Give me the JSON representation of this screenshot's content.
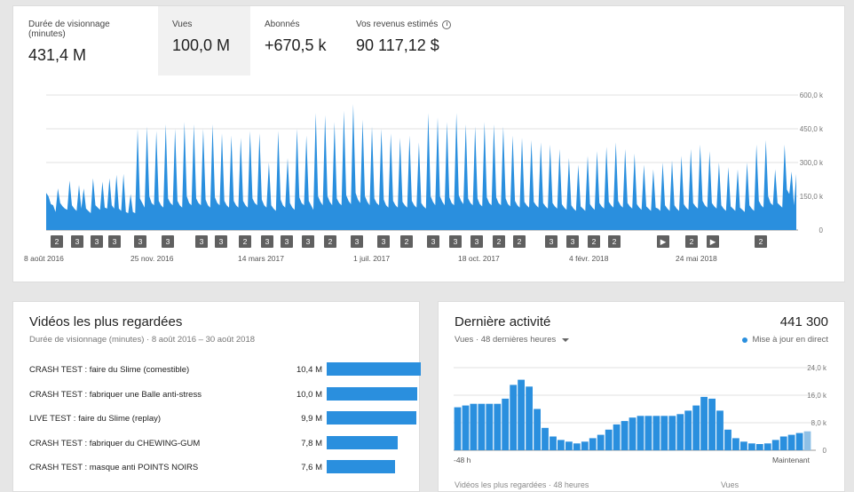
{
  "metrics": [
    {
      "label": "Durée de visionnage (minutes)",
      "value": "431,4 M",
      "active": false
    },
    {
      "label": "Vues",
      "value": "100,0 M",
      "active": true
    },
    {
      "label": "Abonnés",
      "value": "+670,5 k",
      "active": false
    },
    {
      "label": "Vos revenus estimés",
      "value": "90 117,12 $",
      "active": false
    }
  ],
  "chart_data": [
    {
      "type": "area",
      "series": [
        {
          "values": [
            165,
            150,
            115,
            110,
            80,
            185,
            120,
            105,
            95,
            90,
            220,
            110,
            95,
            85,
            200,
            95,
            185,
            95,
            85,
            75,
            230,
            110,
            100,
            90,
            215,
            100,
            95,
            230,
            110,
            95,
            245,
            95,
            85,
            250,
            80,
            75,
            160,
            80,
            75,
            450,
            140,
            120,
            100,
            460,
            150,
            120,
            110,
            440,
            130,
            110,
            100,
            470,
            140,
            120,
            110,
            450,
            130,
            110,
            100,
            480,
            150,
            120,
            110,
            470,
            140,
            120,
            110,
            450,
            135,
            110,
            100,
            470,
            145,
            120,
            110,
            430,
            130,
            110,
            100,
            420,
            130,
            110,
            100,
            410,
            130,
            110,
            100,
            440,
            140,
            120,
            110,
            430,
            135,
            110,
            100,
            300,
            110,
            95,
            85,
            440,
            135,
            110,
            100,
            320,
            120,
            100,
            90,
            450,
            145,
            120,
            110,
            420,
            130,
            110,
            90,
            520,
            150,
            125,
            110,
            510,
            150,
            125,
            110,
            480,
            140,
            120,
            110,
            530,
            155,
            130,
            115,
            560,
            165,
            135,
            120,
            490,
            150,
            125,
            110,
            460,
            140,
            120,
            110,
            450,
            135,
            110,
            100,
            430,
            130,
            110,
            100,
            410,
            125,
            110,
            100,
            420,
            130,
            110,
            100,
            390,
            120,
            105,
            95,
            520,
            150,
            125,
            110,
            500,
            150,
            125,
            110,
            480,
            145,
            120,
            110,
            520,
            155,
            130,
            115,
            470,
            140,
            120,
            110,
            460,
            140,
            115,
            105,
            480,
            145,
            120,
            110,
            470,
            145,
            120,
            110,
            460,
            140,
            115,
            105,
            420,
            130,
            110,
            100,
            410,
            125,
            110,
            100,
            400,
            125,
            110,
            100,
            390,
            120,
            105,
            95,
            380,
            120,
            105,
            95,
            360,
            115,
            100,
            90,
            320,
            110,
            95,
            85,
            290,
            105,
            95,
            85,
            330,
            115,
            100,
            90,
            350,
            120,
            105,
            95,
            370,
            125,
            110,
            100,
            390,
            130,
            110,
            100,
            360,
            120,
            105,
            95,
            340,
            115,
            100,
            90,
            290,
            105,
            95,
            85,
            270,
            100,
            95,
            85,
            300,
            110,
            95,
            85,
            310,
            110,
            95,
            85,
            330,
            115,
            100,
            90,
            360,
            120,
            105,
            95,
            380,
            130,
            110,
            100,
            350,
            120,
            105,
            95,
            300,
            110,
            95,
            85,
            280,
            105,
            95,
            85,
            270,
            100,
            90,
            80,
            300,
            110,
            95,
            85,
            380,
            130,
            110,
            100,
            400,
            150,
            120,
            110,
            270,
            120,
            110,
            100,
            380,
            180,
            160,
            260,
            110,
            250
          ]
        }
      ],
      "yticks": [
        "600,0 k",
        "450,0 k",
        "300,0 k",
        "150,0 k",
        "0"
      ],
      "ylim": [
        0,
        600
      ],
      "xticks": [
        "8 août 2016",
        "25 nov. 2016",
        "14 mars 2017",
        "1 juil. 2017",
        "18 oct. 2017",
        "4 févr. 2018",
        "24 mai 2018"
      ],
      "markers": [
        "2",
        "3",
        "3",
        "3",
        "3",
        "3",
        "3",
        "3",
        "2",
        "3",
        "3",
        "3",
        "2",
        "3",
        "3",
        "2",
        "3",
        "3",
        "3",
        "2",
        "2",
        "3",
        "3",
        "2",
        "2",
        "▶",
        "2",
        "▶",
        "2"
      ],
      "grid": true
    },
    {
      "type": "bar",
      "series": [
        {
          "name": "Vues",
          "values": [
            12.5,
            13,
            13.5,
            13.5,
            13.5,
            13.5,
            15,
            19,
            20.5,
            18.5,
            12,
            6.5,
            4,
            3,
            2.5,
            2,
            2.5,
            3.5,
            4.5,
            6,
            7.5,
            8.5,
            9.5,
            10,
            10,
            10,
            10,
            10,
            10.5,
            11.5,
            13,
            15.5,
            15,
            11.5,
            6,
            3.5,
            2.5,
            2,
            1.8,
            2,
            3,
            4,
            4.5,
            5,
            5.5
          ]
        }
      ],
      "yticks": [
        "24,0 k",
        "16,0 k",
        "8,0 k",
        "0"
      ],
      "ylim": [
        0,
        24
      ],
      "xticks": [
        "-48 h",
        "Maintenant"
      ],
      "grid": true
    }
  ],
  "top_videos": {
    "title": "Vidéos les plus regardées",
    "subtitle": "Durée de visionnage (minutes) · 8 août 2016 – 30 août 2018",
    "items": [
      {
        "title": "CRASH TEST : faire du Slime (comestible)",
        "value": "10,4 M",
        "fraction": 1.0
      },
      {
        "title": "CRASH TEST : fabriquer une Balle anti-stress",
        "value": "10,0 M",
        "fraction": 0.962
      },
      {
        "title": "LIVE TEST : faire du Slime (replay)",
        "value": "9,9 M",
        "fraction": 0.952
      },
      {
        "title": "CRASH TEST : fabriquer du CHEWING-GUM",
        "value": "7,8 M",
        "fraction": 0.75
      },
      {
        "title": "CRASH TEST : masque anti POINTS NOIRS",
        "value": "7,6 M",
        "fraction": 0.731
      }
    ]
  },
  "recent": {
    "title": "Dernière activité",
    "total": "441 300",
    "selector": "Vues · 48 dernières heures",
    "live": "Mise à jour en direct",
    "footer_left": "Vidéos les plus regardées · 48 heures",
    "footer_right": "Vues"
  },
  "colors": {
    "accent": "#2a8fde",
    "bar_last": "#8fc0e6"
  }
}
